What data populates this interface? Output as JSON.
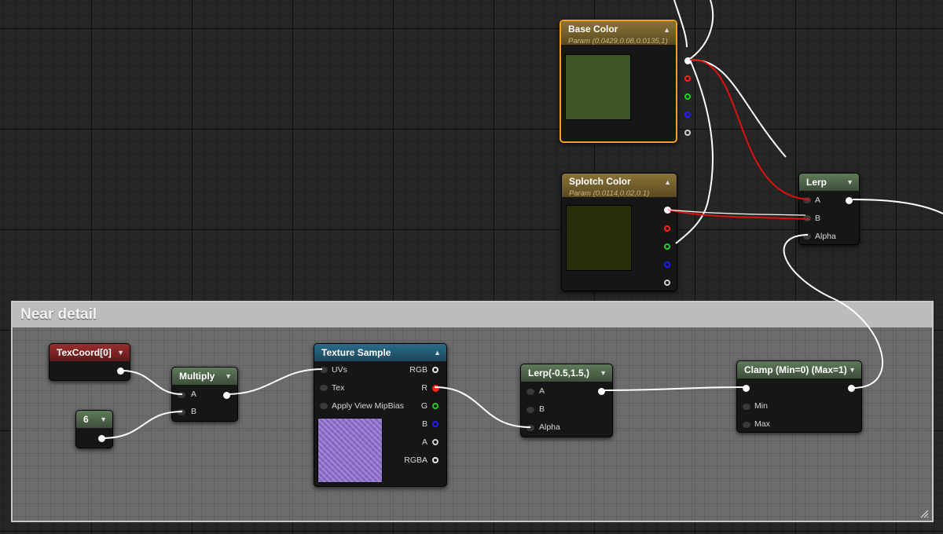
{
  "comment": {
    "title": "Near detail"
  },
  "nodes": {
    "base_color": {
      "title": "Base Color",
      "subtitle": "Param (0.0429,0.08,0.0135,1)",
      "color": "#3e5625"
    },
    "splotch_color": {
      "title": "Splotch Color",
      "subtitle": "Param (0.0114,0.02,0.1)",
      "color": "#262f0a"
    },
    "lerp_top": {
      "title": "Lerp",
      "inputs": [
        "A",
        "B",
        "Alpha"
      ]
    },
    "texcoord": {
      "title": "TexCoord[0]"
    },
    "constant": {
      "title": "6"
    },
    "multiply": {
      "title": "Multiply",
      "inputs": [
        "A",
        "B"
      ]
    },
    "texture_sample": {
      "title": "Texture Sample",
      "inputs": [
        "UVs",
        "Tex",
        "Apply View MipBias"
      ],
      "outputs": [
        "RGB",
        "R",
        "G",
        "B",
        "A",
        "RGBA"
      ]
    },
    "lerp_range": {
      "title": "Lerp(-0.5,1.5,)",
      "inputs": [
        "A",
        "B",
        "Alpha"
      ]
    },
    "clamp": {
      "title": "Clamp (Min=0) (Max=1)",
      "inputs": [
        "Min",
        "Max"
      ]
    }
  },
  "colors": {
    "selected_border": "#f0a21c",
    "wire": "#ffffff",
    "wire_red": "#e01010",
    "pin_red": "#ff2020",
    "pin_green": "#20d020",
    "pin_blue": "#2020ff",
    "pin_grey": "#cfcfcf"
  }
}
